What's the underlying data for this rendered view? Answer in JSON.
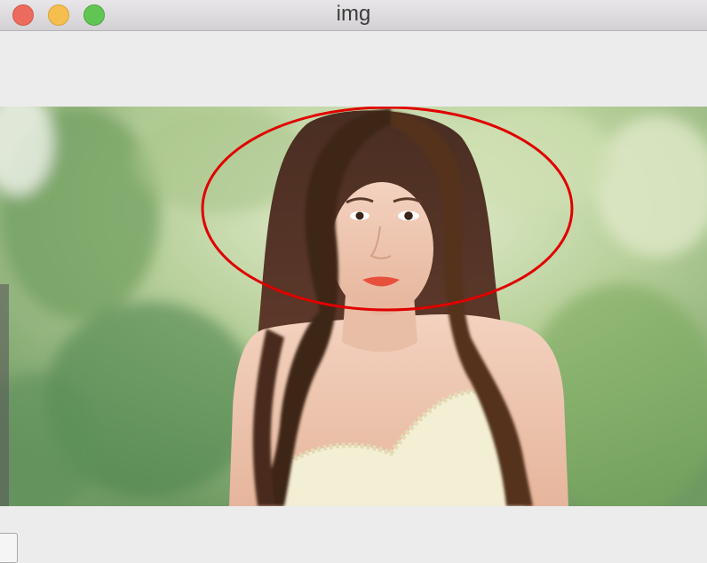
{
  "window": {
    "title": "img",
    "controls": {
      "close_color": "#ed6a5e",
      "minimize_color": "#f5bf4f",
      "zoom_color": "#61c554"
    }
  },
  "image": {
    "subject": "woman-with-long-brown-hair-outdoors",
    "annotation_color": "#e00000"
  }
}
